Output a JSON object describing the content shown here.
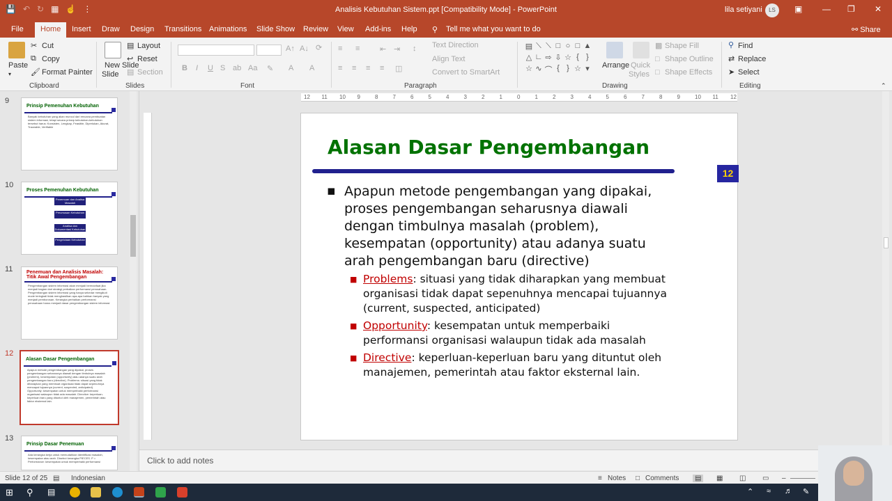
{
  "window": {
    "title": "Analisis Kebutuhan Sistem.ppt [Compatibility Mode]  -  PowerPoint",
    "user_name": "lila setiyani",
    "user_initials": "LS",
    "share_label": "Share"
  },
  "tabs": [
    {
      "label": "File"
    },
    {
      "label": "Home"
    },
    {
      "label": "Insert"
    },
    {
      "label": "Draw"
    },
    {
      "label": "Design"
    },
    {
      "label": "Transitions"
    },
    {
      "label": "Animations"
    },
    {
      "label": "Slide Show"
    },
    {
      "label": "Review"
    },
    {
      "label": "View"
    },
    {
      "label": "Add-ins"
    },
    {
      "label": "Help"
    }
  ],
  "tell_me": "Tell me what you want to do",
  "ribbon": {
    "clipboard": {
      "label": "Clipboard",
      "paste": "Paste",
      "cut": "Cut",
      "copy": "Copy",
      "format_painter": "Format Painter"
    },
    "slides": {
      "label": "Slides",
      "new_slide": "New Slide",
      "new_slide_2": "Slide",
      "layout": "Layout",
      "reset": "Reset",
      "section": "Section"
    },
    "font": {
      "label": "Font",
      "bold": "B",
      "italic": "I",
      "underline": "U",
      "strike": "S"
    },
    "paragraph": {
      "label": "Paragraph",
      "text_direction": "Text Direction",
      "align_text": "Align Text",
      "convert_smartart": "Convert to SmartArt"
    },
    "drawing": {
      "label": "Drawing",
      "arrange": "Arrange",
      "quick_styles": "Quick",
      "quick_styles_2": "Styles",
      "shape_fill": "Shape Fill",
      "shape_outline": "Shape Outline",
      "shape_effects": "Shape Effects"
    },
    "editing": {
      "label": "Editing",
      "find": "Find",
      "replace": "Replace",
      "select": "Select"
    }
  },
  "ruler_labels": [
    "12",
    "11",
    "10",
    "9",
    "8",
    "7",
    "6",
    "5",
    "4",
    "3",
    "2",
    "1",
    "0",
    "1",
    "2",
    "3",
    "4",
    "5",
    "6",
    "7",
    "8",
    "9",
    "10",
    "11",
    "12"
  ],
  "thumbnails": [
    {
      "num": "9",
      "title": "Prinsip Pemenuhan Kebutuhan",
      "text": "Banyak kebutuhan yang akan muncul dari rencana pembuatan sistem informasi, tetapi secara prinsip kebutuhan-kebutuhan tersebut harus: Konsisten, Lengkap, Feasible, Diperlukan, Akurat, Traceable, Verifiable"
    },
    {
      "num": "10",
      "title": "Proses Pemenuhan Kebutuhan",
      "boxes": [
        "Penemuan dan Analisa Masalah",
        "Perumusan Kebutuhan",
        "Analisa dan Dokumentasi Kebutuhan",
        "Pengelolaan Kebutuhan"
      ]
    },
    {
      "num": "11",
      "title": "Penemuan dan Analisis Masalah: Titik Awal Pengembangan",
      "text": "Pengembangan sistem informasi akan menjadi bermanfaat jika menjadi bagian dari strategi perbaikan performansi perusahaan. Pengembangan sistem informasi yang hanya sekedar mengikuti mode teringkali tidak menghasilkan apa-apa bahkan banyak yang menjadi pemborosan. Kerangka perbaikan performansi perusahaan harus menjadi dasar pengembangan sistem informasi"
    },
    {
      "num": "12",
      "title": "Alasan Dasar Pengembangan",
      "text": "Apapun metode pengembangan yang dipakai, proses pengembangan seharusnya diawali dengan timbulnya masalah (problem), kesempatan (opportunity) atau adanya suatu arah pengembangan baru (directive). Problems: situasi yang tidak diharapkan yang membuat organisasi tidak dapat sepenuhnya mencapai tujuannya (current, suspected, anticipated). Opportunity: kesempatan untuk memperbaiki performansi organisasi walaupun tidak ada masalah. Directive: keperluan-keperluan baru yang dituntut oleh manajemen, pemerintah atau faktor eksternal lain."
    },
    {
      "num": "13",
      "title": "Prinsip Dasar Penemuan",
      "text": "Ada kerangka kerja untuk memudahkan identifikasi masalah, kesempatan atau arah. Disebut kerangka PIECES. P = Performance: kesempatan untuk memperbaiki performansi"
    }
  ],
  "slide": {
    "title": "Alasan Dasar Pengembangan",
    "number": "12",
    "bullet_marker": "▪",
    "main_bullet_lines": [
      "Apapun metode pengembangan yang dipakai,",
      "proses pengembangan seharusnya diawali",
      "dengan timbulnya masalah (problem),",
      "kesempatan (opportunity) atau adanya suatu",
      "arah pengembangan baru (directive)"
    ],
    "sub_bullets": [
      {
        "keyword": "Problems",
        "lines": [
          ": situasi yang tidak diharapkan yang membuat",
          "organisasi tidak dapat sepenuhnya mencapai tujuannya",
          "(current, suspected, anticipated)"
        ]
      },
      {
        "keyword": "Opportunity",
        "lines": [
          ": kesempatan untuk memperbaiki",
          "performansi organisasi walaupun tidak ada masalah"
        ]
      },
      {
        "keyword": "Directive",
        "lines": [
          ": keperluan-keperluan baru yang dituntut oleh",
          "manajemen, pemerintah atau faktor eksternal lain."
        ]
      }
    ]
  },
  "notes_placeholder": "Click to add notes",
  "status": {
    "slide_info": "Slide 12 of 25",
    "language": "Indonesian",
    "notes": "Notes",
    "comments": "Comments"
  },
  "colors": {
    "accent": "#b7472a",
    "slide_title": "#007200",
    "keyword": "#c00000",
    "navy": "#2626a0"
  }
}
